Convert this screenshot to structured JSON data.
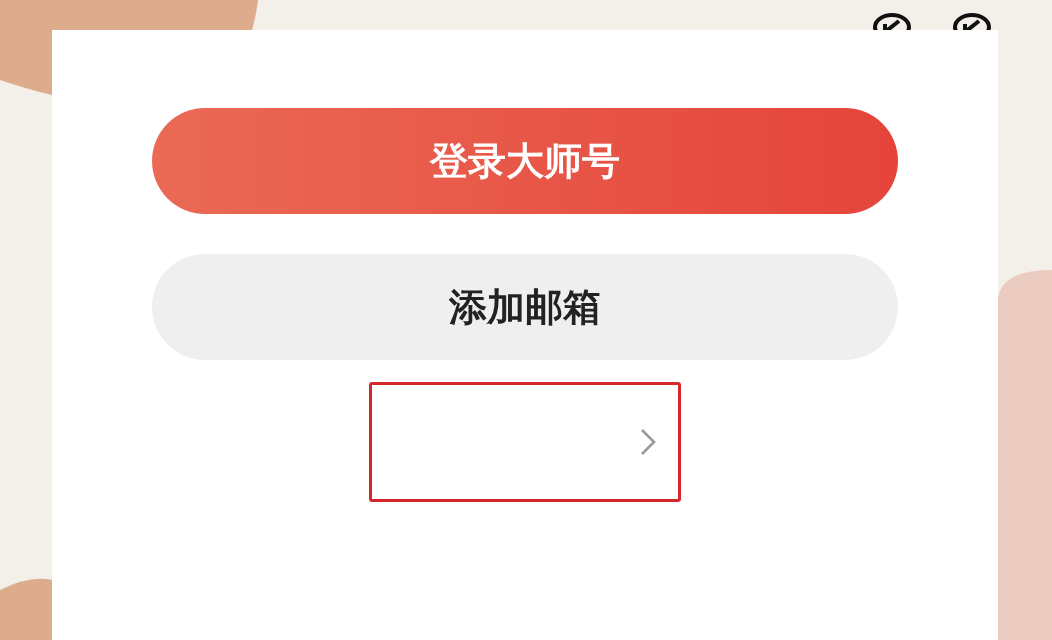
{
  "buttons": [
    {
      "label": "登录大师号",
      "kind": "primary"
    },
    {
      "label": "添加邮箱",
      "kind": "secondary"
    }
  ],
  "entry_row": {
    "highlighted": true
  }
}
